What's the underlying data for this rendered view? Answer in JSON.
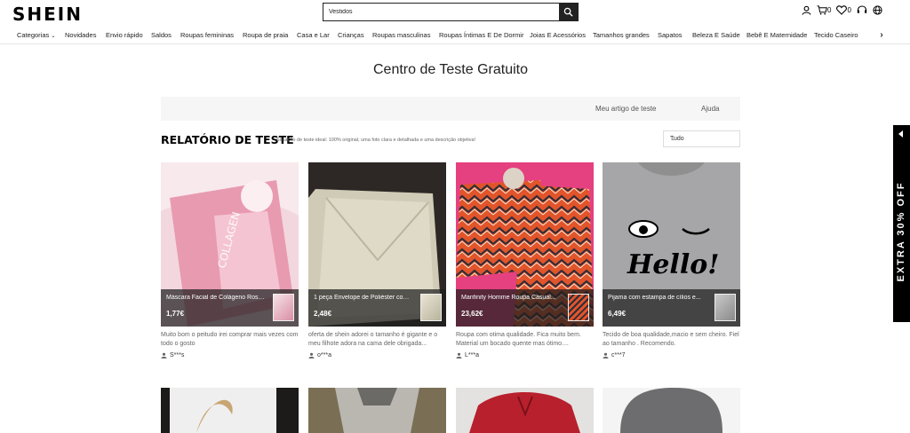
{
  "header": {
    "logo": "SHEIN",
    "search_value": "Vestidos",
    "cart_count": "0",
    "wishlist_count": "0",
    "icons": [
      "user-icon",
      "cart-icon",
      "heart-icon",
      "headset-icon",
      "globe-icon",
      "search-icon"
    ]
  },
  "nav": {
    "items": [
      "Categorias",
      "Novidades",
      "Envio rápido",
      "Saldos",
      "Roupas femininas",
      "Roupa de praia",
      "Casa e Lar",
      "Crianças",
      "Roupas masculinas",
      "Roupas Íntimas E De Dormir",
      "Joias E Acessórios",
      "Tamanhos grandes",
      "Sapatos",
      "Beleza E Saúde",
      "Bebê E Maternidade",
      "Tecido Caseiro"
    ]
  },
  "page": {
    "title": "Centro de Teste Gratuito",
    "tabs": [
      "Meu artigo de teste",
      "Ajuda"
    ],
    "report_heading": "RELATÓRIO DE TESTE",
    "report_subtitle": "Situação de teste ideal: 100% original, uma foto clara e detalhada e uma descrição objetiva!",
    "filter_selected": "Tudo"
  },
  "cards": [
    {
      "name": "Máscara Facial de Colágeno Rosa...",
      "price": "1,77€",
      "review": "Muito bom o peitudo irei comprar mais vezes com todo o gosto",
      "user": "S***s"
    },
    {
      "name": "1 peça Envelope de Poliéster com...",
      "price": "2,48€",
      "review": "oferta de shein adorei o tamanho é gigante e o meu filhote adora na cama dele obrigada...",
      "user": "o***a"
    },
    {
      "name": "Manfinity Homme Roupa Casual...",
      "price": "23,62€",
      "review": "Roupa com otima qualidade. Fica muito bem. Material um bocado quente mas ótimo....",
      "user": "L***a"
    },
    {
      "name": "Pijama com estampa de cílios e...",
      "price": "6,49€",
      "review": "Tecido de boa qualidade,macio e sem cheiro. Fiel ao tamanho . Recomendo.",
      "user": "c***7"
    }
  ],
  "promo": {
    "label": "EXTRA 30% OFF"
  },
  "colors": {
    "header_text": "#000000",
    "tab_bar_bg": "#f6f6f6",
    "overlay": "#1e1e1e",
    "promo_bg": "#000000"
  }
}
